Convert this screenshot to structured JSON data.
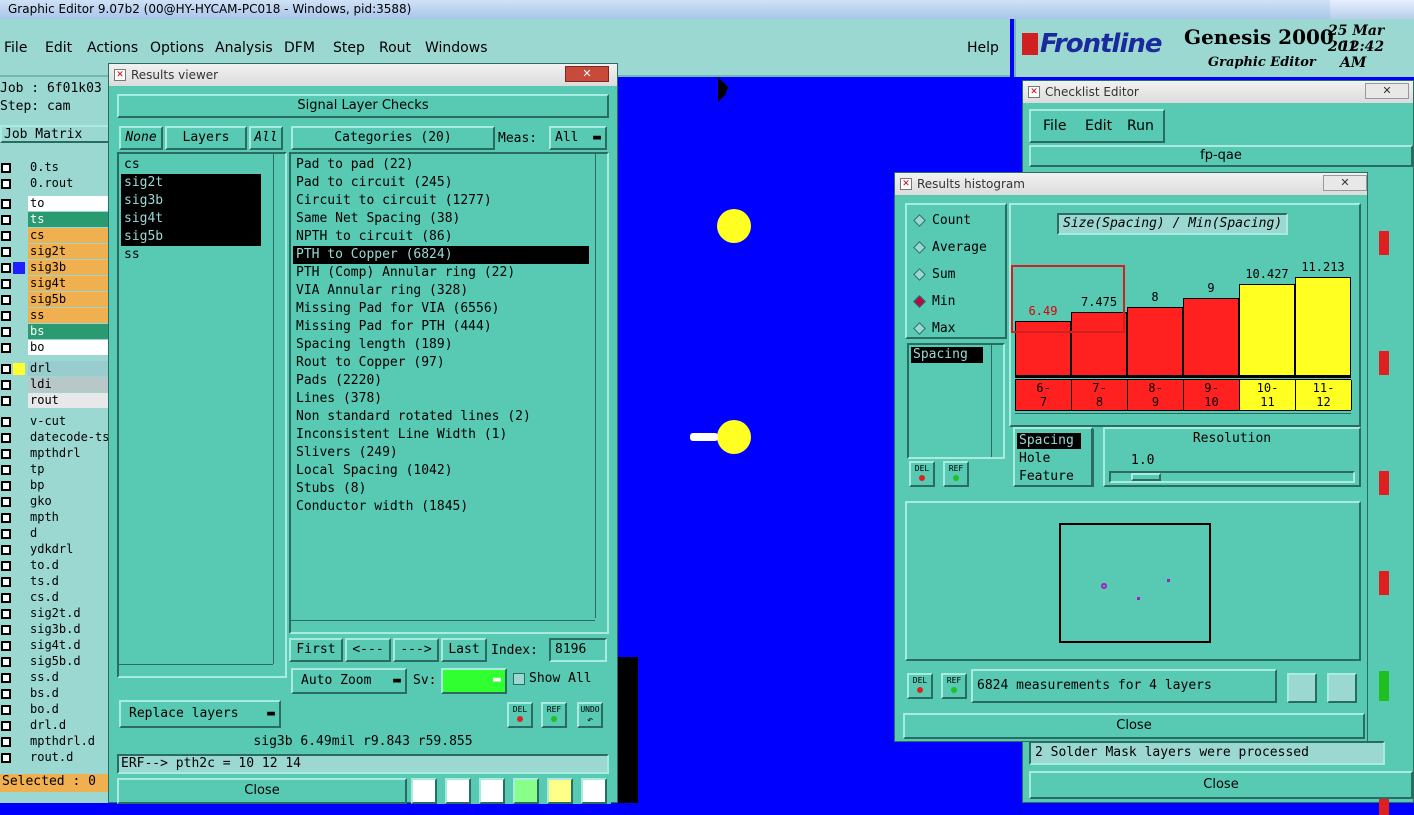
{
  "app": {
    "title": "Graphic Editor 9.07b2 (00@HY-HYCAM-PC018 - Windows, pid:3588)",
    "menu": [
      "File",
      "Edit",
      "Actions",
      "Options",
      "Analysis",
      "DFM",
      "Step",
      "Rout",
      "Windows"
    ],
    "help": "Help"
  },
  "brand": {
    "logo": "Frontline",
    "product": "Genesis 2000",
    "subtitle": "Graphic Editor",
    "date": "25 Mar 201",
    "time": "12:42 AM"
  },
  "left_panel": {
    "job": "Job : 6f01k03",
    "step": "Step: cam",
    "job_matrix": "Job Matrix",
    "selected": "Selected : 0",
    "layers": [
      {
        "name": "0.ts",
        "color": "#9cd8d2",
        "text": "#000"
      },
      {
        "name": "0.rout",
        "color": "#9cd8d2",
        "text": "#000"
      },
      {
        "name": "to",
        "color": "#ffffff",
        "text": "#000"
      },
      {
        "name": "ts",
        "color": "#2a9a70",
        "text": "#fff"
      },
      {
        "name": "cs",
        "color": "#f0b050",
        "text": "#000"
      },
      {
        "name": "sig2t",
        "color": "#f0b050",
        "text": "#000"
      },
      {
        "name": "sig3b",
        "color": "#f0b050",
        "text": "#000"
      },
      {
        "name": "sig4t",
        "color": "#f0b050",
        "text": "#000"
      },
      {
        "name": "sig5b",
        "color": "#f0b050",
        "text": "#000"
      },
      {
        "name": "ss",
        "color": "#f0b050",
        "text": "#000"
      },
      {
        "name": "bs",
        "color": "#2a9a70",
        "text": "#fff"
      },
      {
        "name": "bo",
        "color": "#ffffff",
        "text": "#000"
      },
      {
        "name": "drl",
        "color": "#9cc",
        "text": "#000"
      },
      {
        "name": "ldi",
        "color": "#b8c8c8",
        "text": "#000"
      },
      {
        "name": "rout",
        "color": "#e8e8e8",
        "text": "#000"
      },
      {
        "name": "v-cut",
        "color": "#9cd8d2",
        "text": "#000"
      },
      {
        "name": "datecode-ts",
        "color": "#9cd8d2",
        "text": "#000"
      },
      {
        "name": "mpthdrl",
        "color": "#9cd8d2",
        "text": "#000"
      },
      {
        "name": "tp",
        "color": "#9cd8d2",
        "text": "#000"
      },
      {
        "name": "bp",
        "color": "#9cd8d2",
        "text": "#000"
      },
      {
        "name": "gko",
        "color": "#9cd8d2",
        "text": "#000"
      },
      {
        "name": "mpth",
        "color": "#9cd8d2",
        "text": "#000"
      },
      {
        "name": "d",
        "color": "#9cd8d2",
        "text": "#000"
      },
      {
        "name": "ydkdrl",
        "color": "#9cd8d2",
        "text": "#000"
      },
      {
        "name": "to.d",
        "color": "#9cd8d2",
        "text": "#000"
      },
      {
        "name": "ts.d",
        "color": "#9cd8d2",
        "text": "#000"
      },
      {
        "name": "cs.d",
        "color": "#9cd8d2",
        "text": "#000"
      },
      {
        "name": "sig2t.d",
        "color": "#9cd8d2",
        "text": "#000"
      },
      {
        "name": "sig3b.d",
        "color": "#9cd8d2",
        "text": "#000"
      },
      {
        "name": "sig4t.d",
        "color": "#9cd8d2",
        "text": "#000"
      },
      {
        "name": "sig5b.d",
        "color": "#9cd8d2",
        "text": "#000"
      },
      {
        "name": "ss.d",
        "color": "#9cd8d2",
        "text": "#000"
      },
      {
        "name": "bs.d",
        "color": "#9cd8d2",
        "text": "#000"
      },
      {
        "name": "bo.d",
        "color": "#9cd8d2",
        "text": "#000"
      },
      {
        "name": "drl.d",
        "color": "#9cd8d2",
        "text": "#000"
      },
      {
        "name": "mpthdrl.d",
        "color": "#9cd8d2",
        "text": "#000"
      },
      {
        "name": "rout.d",
        "color": "#9cd8d2",
        "text": "#000"
      }
    ]
  },
  "results_viewer": {
    "title": "Results viewer",
    "header": "Signal Layer Checks",
    "none_btn": "None",
    "layers_btn": "Layers",
    "all_btn": "All",
    "categories_label": "Categories (20)",
    "meas_label": "Meas:",
    "meas_value": "All",
    "layers": [
      "cs",
      "sig2t",
      "sig3b",
      "sig4t",
      "sig5b",
      "ss"
    ],
    "categories": [
      "Pad to pad (22)",
      "Pad to circuit (245)",
      "Circuit to circuit (1277)",
      "Same Net Spacing (38)",
      "NPTH to circuit (86)",
      "PTH to Copper (6824)",
      "PTH (Comp) Annular ring (22)",
      "VIA Annular ring (328)",
      "Missing Pad for VIA (6556)",
      "Missing Pad for PTH (444)",
      "Spacing length (189)",
      "Rout to Copper (97)",
      "Pads (2220)",
      "Lines (378)",
      "Non standard rotated lines (2)",
      "Inconsistent Line Width (1)",
      "Slivers (249)",
      "Local Spacing (1042)",
      "Stubs (8)",
      "Conductor width (1845)"
    ],
    "first": "First",
    "prev": "<---",
    "next": "--->",
    "last": "Last",
    "index_label": "Index:",
    "index_value": "8196",
    "auto_zoom": "Auto Zoom",
    "sv_label": "Sv:",
    "show_all": "Show  All",
    "replace_layers": "Replace layers",
    "del": "DEL",
    "ref": "REF",
    "undo": "UNDO",
    "status": "sig3b  6.49mil   r9.843   r59.855",
    "erf": "ERF--> pth2c = 10 12 14",
    "close": "Close"
  },
  "checklist_editor": {
    "title": "Checklist Editor",
    "menu": [
      "File",
      "Edit",
      "Run"
    ],
    "name": "fp-qae",
    "message": "2 Solder Mask layers were processed",
    "close": "Close"
  },
  "histogram": {
    "title": "Results histogram",
    "modes": [
      {
        "label": "Count",
        "on": false
      },
      {
        "label": "Average",
        "on": false
      },
      {
        "label": "Sum",
        "on": false
      },
      {
        "label": "Min",
        "on": true
      },
      {
        "label": "Max",
        "on": false
      }
    ],
    "chart_title": "Size(Spacing) / Min(Spacing)",
    "list_item": "Spacing",
    "hole_options": [
      "Spacing",
      "Hole",
      "Feature"
    ],
    "resolution_label": "Resolution",
    "resolution_value": "1.0",
    "measurements": "6824 measurements for 4 layers",
    "close": "Close",
    "del": "DEL",
    "ref": "REF"
  },
  "chart_data": {
    "type": "bar",
    "title": "Size(Spacing) / Min(Spacing)",
    "categories": [
      "6-\n7",
      "7-\n8",
      "8-\n9",
      "9-\n10",
      "10-\n11",
      "11-\n12"
    ],
    "values": [
      6.49,
      7.475,
      8,
      9,
      10.427,
      11.213
    ],
    "value_labels": [
      "6.49",
      "7.475",
      "8",
      "9",
      "10.427",
      "11.213"
    ],
    "colors": [
      "#ff2020",
      "#ff2020",
      "#ff2020",
      "#ff2020",
      "#ffff22",
      "#ffff22"
    ],
    "ylim": [
      0,
      12
    ]
  }
}
